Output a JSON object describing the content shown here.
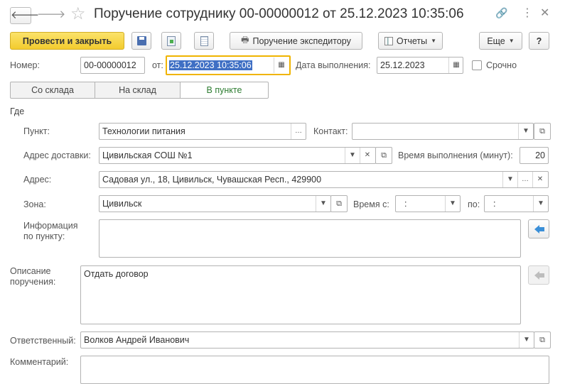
{
  "window": {
    "title": "Поручение сотруднику 00-00000012 от 25.12.2023 10:35:06"
  },
  "toolbar": {
    "post_close": "Провести и закрыть",
    "courier": "Поручение экспедитору",
    "reports": "Отчеты",
    "more": "Еще",
    "help": "?"
  },
  "header": {
    "number_label": "Номер:",
    "number_value": "00-00000012",
    "from_label": "от:",
    "from_value": "25.12.2023 10:35:06",
    "due_label": "Дата выполнения:",
    "due_value": "25.12.2023",
    "urgent_label": "Срочно"
  },
  "tabs": [
    {
      "label": "Со склада",
      "active": false
    },
    {
      "label": "На склад",
      "active": false
    },
    {
      "label": "В пункте",
      "active": true
    }
  ],
  "where": {
    "group_label": "Где",
    "point_label": "Пункт:",
    "point_value": "Технологии питания",
    "contact_label": "Контакт:",
    "contact_value": "",
    "delivery_label": "Адрес доставки:",
    "delivery_value": "Цивильская СОШ №1",
    "time_label": "Время выполнения (минут):",
    "time_value": "20",
    "address_label": "Адрес:",
    "address_value": "Садовая ул., 18, Цивильск, Чувашская Респ., 429900",
    "zone_label": "Зона:",
    "zone_value": "Цивильск",
    "time_from_label": "Время с:",
    "time_from_value": ":",
    "time_to_label": "по:",
    "time_to_value": ":",
    "info_label_1": "Информация",
    "info_label_2": "по пункту:",
    "info_value": ""
  },
  "task": {
    "desc_label_1": "Описание",
    "desc_label_2": "поручения:",
    "desc_value": "Отдать договор",
    "responsible_label": "Ответственный:",
    "responsible_value": "Волков Андрей Иванович",
    "comment_label": "Комментарий:",
    "comment_value": ""
  },
  "colors": {
    "accent_yellow": "#f8d648",
    "focus_border": "#f0b400",
    "selection": "#3f6fc4",
    "active_tab_text": "#2e7d32",
    "arrow_blue": "#3a8fd8"
  }
}
